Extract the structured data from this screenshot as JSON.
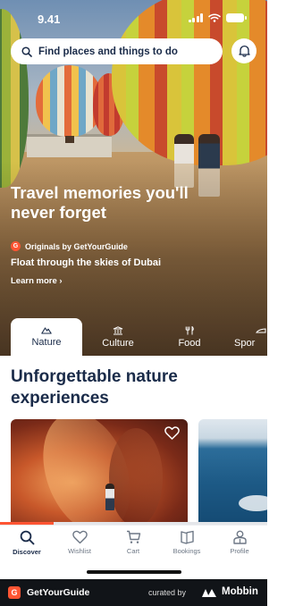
{
  "status_bar": {
    "time": "9.41"
  },
  "search": {
    "placeholder": "Find places and things to do"
  },
  "hero": {
    "title": "Travel memories you'll never forget",
    "originals_label": "Originals by GetYourGuide",
    "originals_badge": "G",
    "subtitle": "Float through the skies of Dubai",
    "learn_more": "Learn more ›"
  },
  "categories": [
    {
      "label": "Nature",
      "icon": "mountain-icon",
      "active": true
    },
    {
      "label": "Culture",
      "icon": "museum-icon",
      "active": false
    },
    {
      "label": "Food",
      "icon": "cutlery-icon",
      "active": false
    },
    {
      "label": "Spor",
      "icon": "sports-icon",
      "active": false
    }
  ],
  "section": {
    "title": "Unforgettable nature experiences"
  },
  "carousel": {
    "progress": 0.2
  },
  "tabbar": [
    {
      "label": "Discover",
      "icon": "search-icon",
      "active": true
    },
    {
      "label": "Wishlist",
      "icon": "heart-icon",
      "active": false
    },
    {
      "label": "Cart",
      "icon": "cart-icon",
      "active": false
    },
    {
      "label": "Bookings",
      "icon": "ticket-icon",
      "active": false
    },
    {
      "label": "Profile",
      "icon": "profile-icon",
      "active": false
    }
  ],
  "footer": {
    "app_badge": "G",
    "app_name": "GetYourGuide",
    "curated_by": "curated by",
    "brand": "Mobbin"
  },
  "colors": {
    "accent": "#ff5533",
    "navy": "#1a2b49"
  }
}
